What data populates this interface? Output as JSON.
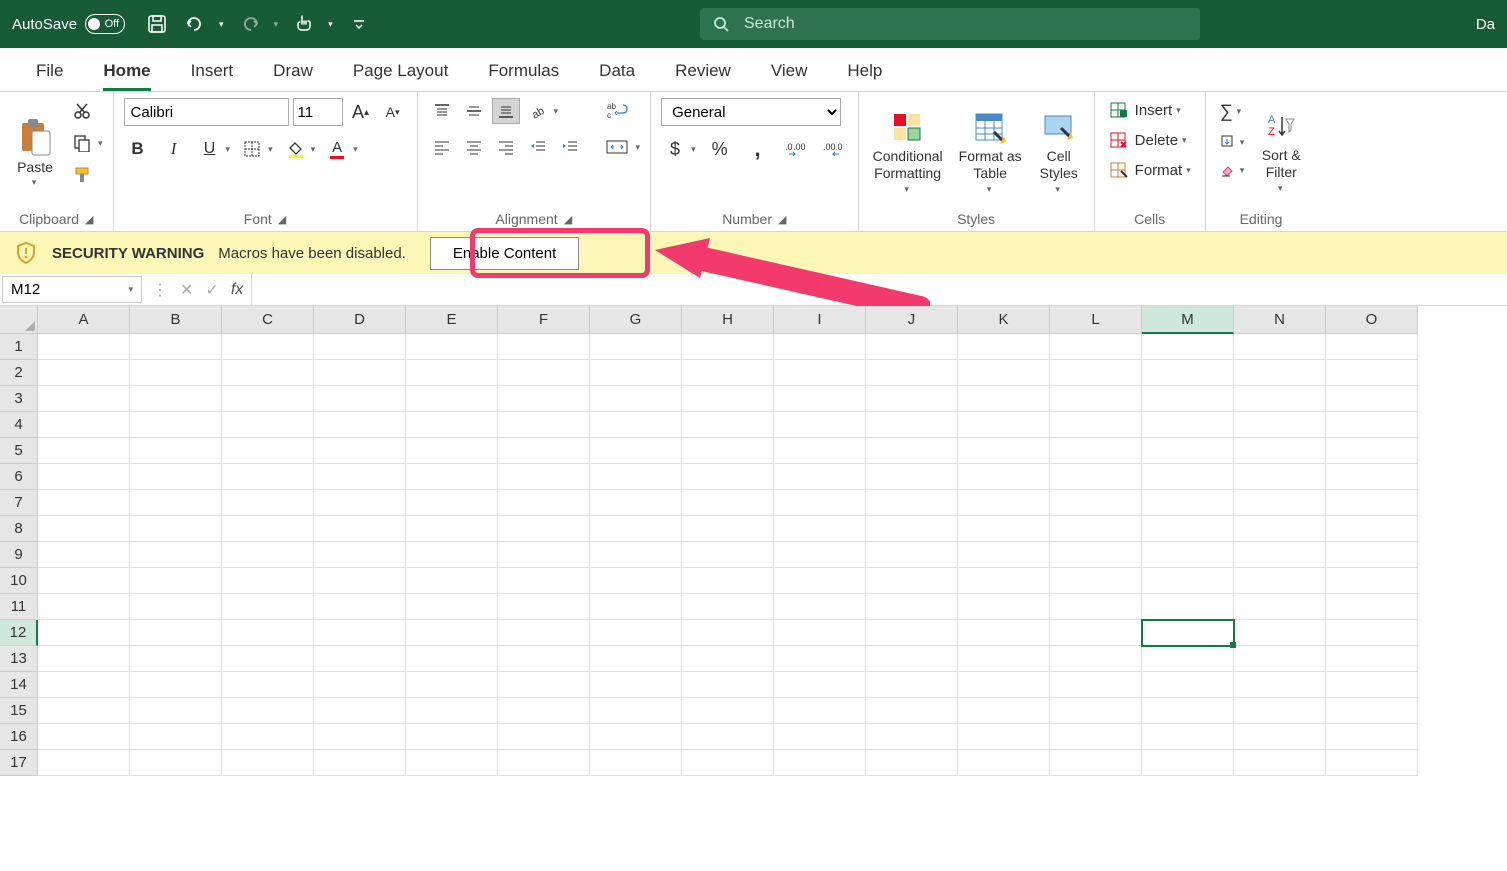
{
  "titlebar": {
    "autosave_label": "AutoSave",
    "autosave_state": "Off",
    "doc_name": "Daily tally",
    "search_placeholder": "Search",
    "right_text": "Da"
  },
  "tabs": [
    "File",
    "Home",
    "Insert",
    "Draw",
    "Page Layout",
    "Formulas",
    "Data",
    "Review",
    "View",
    "Help"
  ],
  "active_tab": "Home",
  "ribbon": {
    "clipboard": {
      "label": "Clipboard",
      "paste": "Paste"
    },
    "font": {
      "label": "Font",
      "name": "Calibri",
      "size": "11"
    },
    "alignment": {
      "label": "Alignment"
    },
    "number": {
      "label": "Number",
      "format": "General"
    },
    "styles": {
      "label": "Styles",
      "conditional": "Conditional\nFormatting",
      "table": "Format as\nTable",
      "cell": "Cell\nStyles"
    },
    "cells": {
      "label": "Cells",
      "insert": "Insert",
      "delete": "Delete",
      "format": "Format"
    },
    "editing": {
      "label": "Editing",
      "sort": "Sort &\nFilter"
    }
  },
  "security": {
    "title": "SECURITY WARNING",
    "message": "Macros have been disabled.",
    "button": "Enable Content"
  },
  "formula_bar": {
    "cell_ref": "M12",
    "fx": "fx",
    "value": ""
  },
  "columns": [
    "A",
    "B",
    "C",
    "D",
    "E",
    "F",
    "G",
    "H",
    "I",
    "J",
    "K",
    "L",
    "M",
    "N",
    "O"
  ],
  "row_count": 17,
  "active_cell": {
    "col": "M",
    "row": 12
  }
}
